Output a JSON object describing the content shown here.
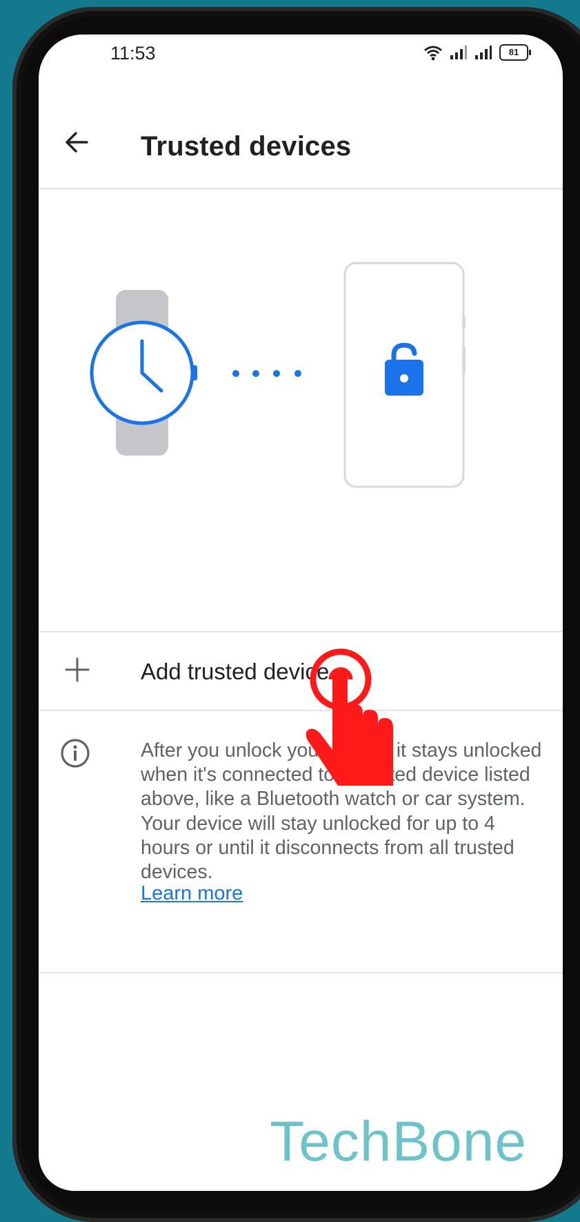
{
  "status_bar": {
    "time": "11:53",
    "battery": "81"
  },
  "header": {
    "title": "Trusted devices",
    "back_icon": "arrow-back-icon"
  },
  "illustration": {
    "watch_icon": "smartwatch-icon",
    "phone_icon": "phone-locked-icon",
    "accent_color": "#1a73e8"
  },
  "add_device": {
    "label": "Add trusted device",
    "icon": "plus-icon"
  },
  "info": {
    "icon": "info-icon",
    "paragraph1": "After you unlock your phone, it stays unlocked when it's connected to a trusted device listed above, like a Bluetooth watch or car system.",
    "paragraph2": "Your device will stay unlocked for up to 4 hours or until it disconnects from all trusted devices.",
    "learn_more": "Learn more"
  },
  "watermark": "TechBone",
  "overlay": {
    "tap_icon": "tap-hand-icon",
    "color": "#ff1a1a"
  },
  "colors": {
    "background": "#127a8c",
    "accent": "#1a73e8",
    "text": "#202124",
    "secondary_text": "#5f6368"
  }
}
